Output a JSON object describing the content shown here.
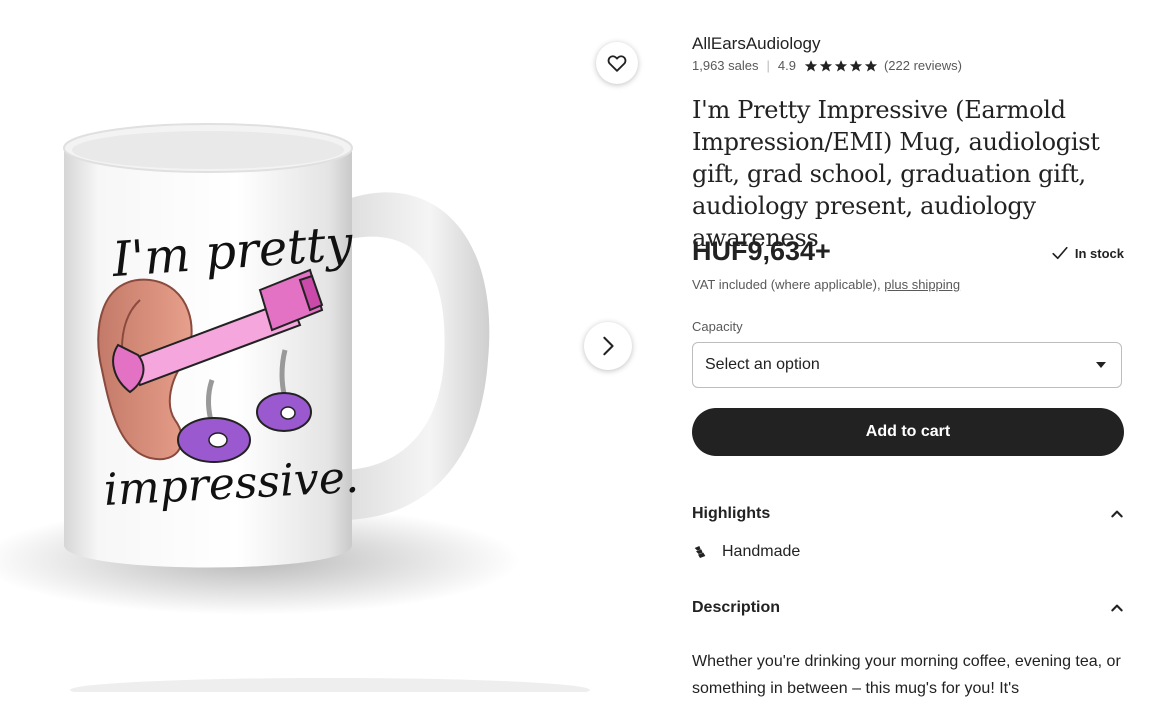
{
  "product_image": {
    "text_line1": "I'm pretty",
    "text_line2": "impressive."
  },
  "favorite": {
    "icon": "heart-icon"
  },
  "carousel": {
    "next_icon": "chevron-right-icon"
  },
  "shop": {
    "name": "AllEarsAudiology",
    "sales": "1,963 sales",
    "rating": "4.9",
    "rating_value": 4.9,
    "rating_max": 5,
    "reviews": "(222 reviews)"
  },
  "listing": {
    "title": "I'm Pretty Impressive (Earmold Impression/EMI) Mug, audiologist gift, grad school, graduation gift, audiology present, audiology awareness",
    "price": "HUF9,634+",
    "stock": "In stock",
    "vat_text": "VAT included (where applicable),",
    "shipping_link": "plus shipping"
  },
  "options": {
    "capacity_label": "Capacity",
    "capacity_value": "Select an option"
  },
  "actions": {
    "add_to_cart": "Add to cart"
  },
  "highlights": {
    "title": "Highlights",
    "items": [
      {
        "label": "Handmade",
        "icon": "hands-icon"
      }
    ]
  },
  "description": {
    "title": "Description",
    "text": "Whether you're drinking your morning coffee, evening tea, or something in between – this mug's for you! It's"
  },
  "colors": {
    "dark": "#222222",
    "muted": "#595959",
    "star": "#222222",
    "pink": "#e472c4"
  }
}
